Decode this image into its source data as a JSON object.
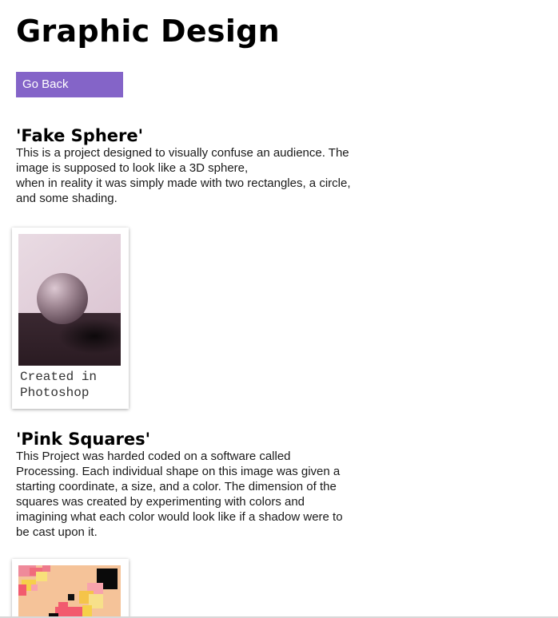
{
  "page": {
    "title": "Graphic Design"
  },
  "nav": {
    "back_label": "Go Back"
  },
  "projects": [
    {
      "title": "'Fake Sphere'",
      "description_lines": [
        "This is a project designed to visually confuse an audience. The",
        "image is supposed to look like a 3D sphere,",
        "when in reality it was simply made with two rectangles, a circle,",
        "and some shading."
      ],
      "caption_lines": [
        "Created in",
        "Photoshop"
      ],
      "image": "fake-sphere-artwork"
    },
    {
      "title": "'Pink Squares'",
      "description_lines": [
        "This Project was harded coded on a software called",
        "Processing. Each individual shape on this image was given a",
        "starting coordinate, a size, and a color. The dimension of the",
        "squares was created by experimenting with colors and",
        "imagining what each color would look like if a shadow were to",
        "be cast upon it."
      ],
      "image": "pink-squares-artwork"
    }
  ],
  "colors": {
    "button": "#8464c8",
    "sphere_background": "#e3d0dc",
    "sphere_floor": "#302028",
    "squares_background": "#f5c399"
  }
}
